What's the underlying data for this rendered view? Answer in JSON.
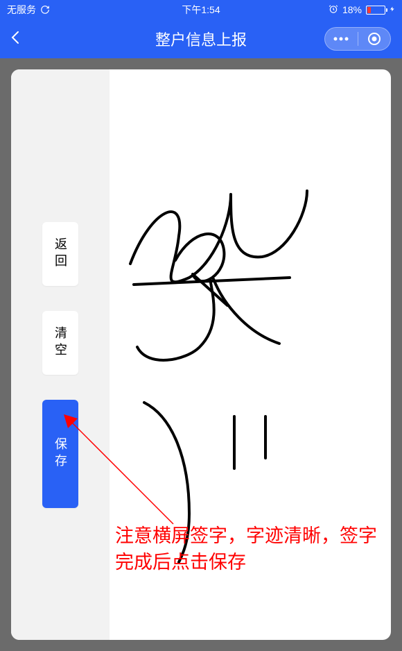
{
  "statusBar": {
    "serviceText": "无服务",
    "time": "下午1:54",
    "batteryPercent": "18%"
  },
  "navBar": {
    "title": "整户信息上报"
  },
  "buttons": {
    "back": "返回",
    "clear": "清空",
    "save": "保存"
  },
  "annotation": {
    "text": "注意横屏签字，字迹清晰，签字完成后点击保存"
  },
  "colors": {
    "primary": "#2961f5",
    "annotation": "#ff0000",
    "batteryLow": "#ff3b30"
  }
}
